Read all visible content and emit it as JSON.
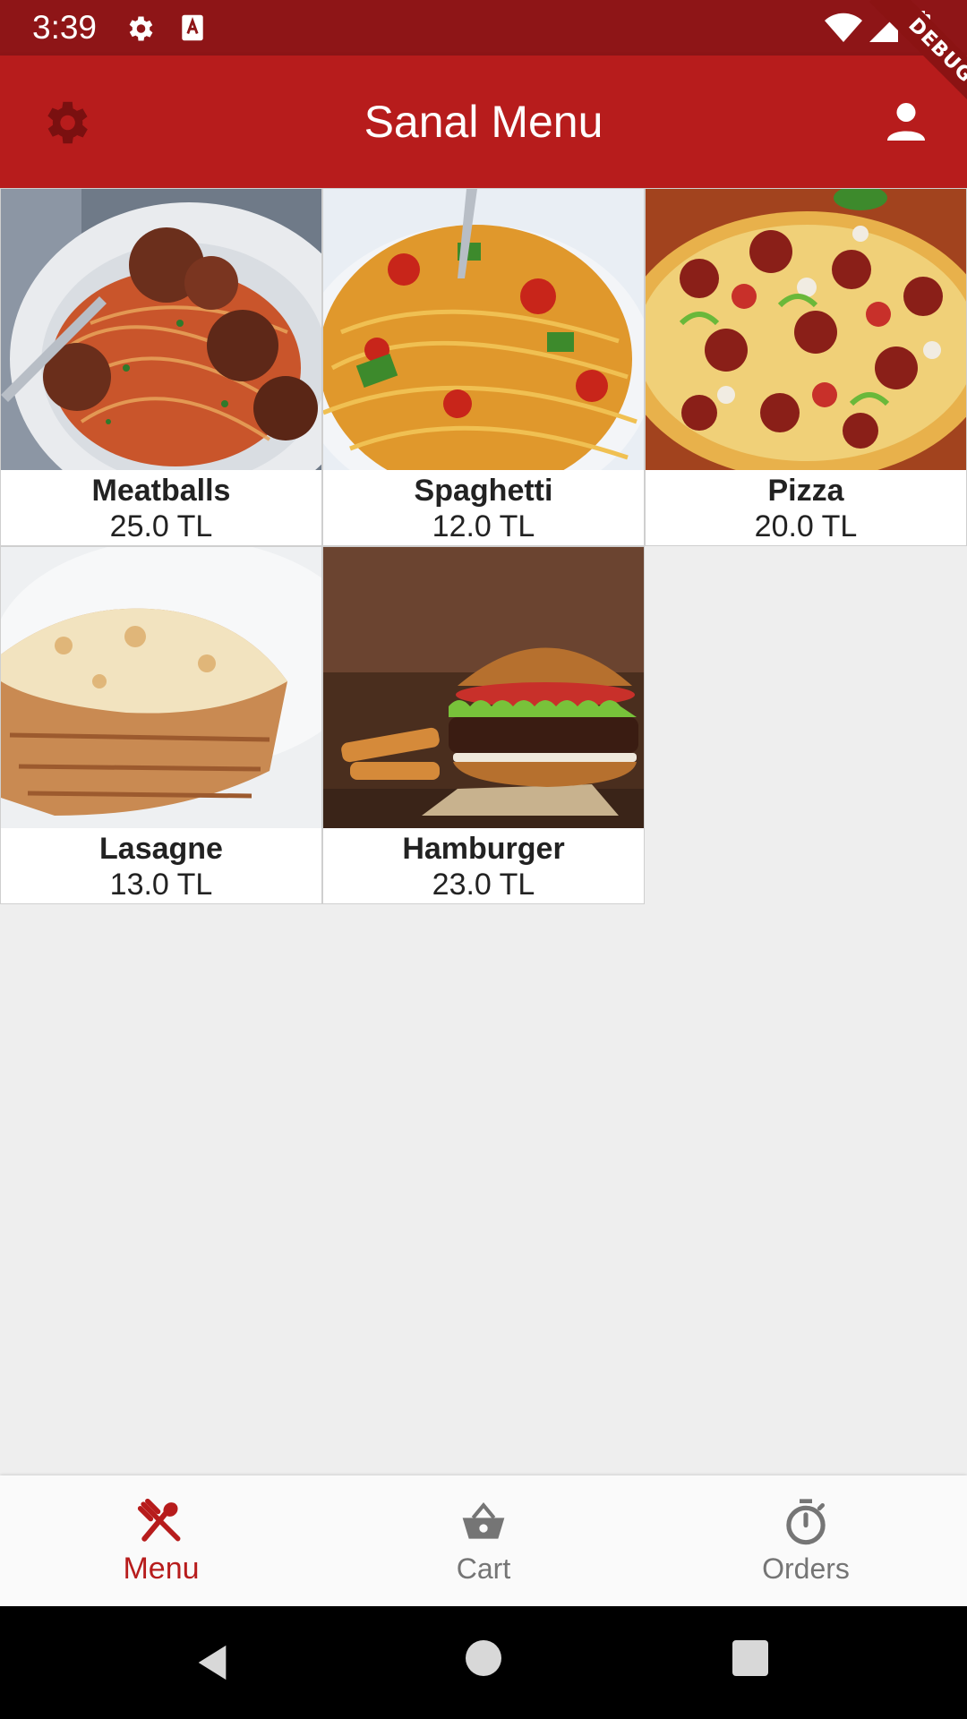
{
  "status_bar": {
    "time": "3:39"
  },
  "debug_banner": "DEBUG",
  "app_bar": {
    "title": "Sanal Menu",
    "left_icon": "gear-icon",
    "right_icon": "person-icon"
  },
  "menu": {
    "items": [
      {
        "name": "Meatballs",
        "price": "25.0 TL"
      },
      {
        "name": "Spaghetti",
        "price": "12.0 TL"
      },
      {
        "name": "Pizza",
        "price": "20.0 TL"
      },
      {
        "name": "Lasagne",
        "price": "13.0 TL"
      },
      {
        "name": "Hamburger",
        "price": "23.0 TL"
      }
    ]
  },
  "bottom_nav": {
    "items": [
      {
        "label": "Menu",
        "icon": "fork-spoon-icon",
        "active": true
      },
      {
        "label": "Cart",
        "icon": "basket-icon",
        "active": false
      },
      {
        "label": "Orders",
        "icon": "stopwatch-icon",
        "active": false
      }
    ],
    "active_color": "#b71c1c",
    "inactive_color": "#757575"
  },
  "colors": {
    "primary": "#b71c1c",
    "status_bar": "#8e1517",
    "background": "#eeeeee"
  }
}
